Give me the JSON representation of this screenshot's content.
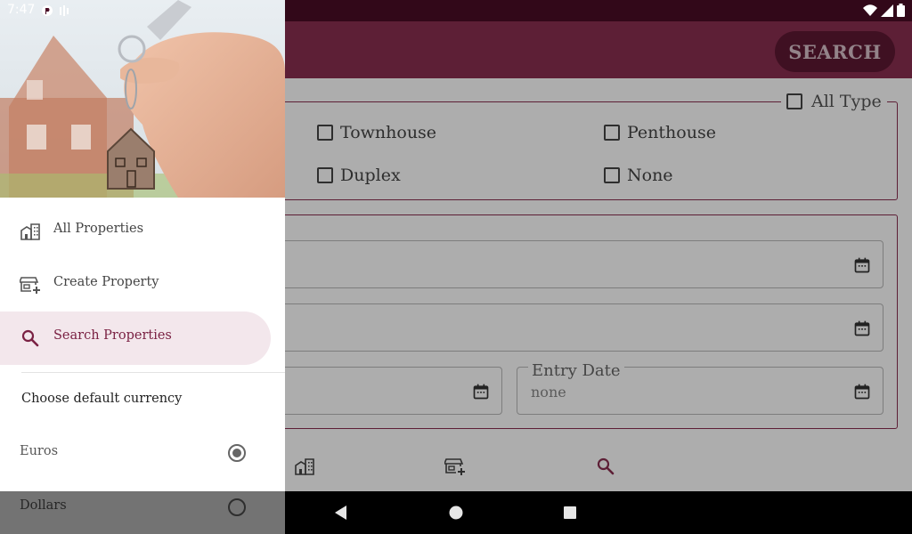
{
  "status_bar": {
    "time": "7:47"
  },
  "app_bar": {
    "search_label": "SEARCH"
  },
  "property_types": {
    "all_label": "All Type",
    "options": [
      "Townhouse",
      "Penthouse",
      "Duplex",
      "None"
    ]
  },
  "date_filters": {
    "entry_date_label": "Entry Date",
    "entry_date_value": "none"
  },
  "drawer": {
    "menu": [
      {
        "label": "All Properties",
        "icon": "building-icon"
      },
      {
        "label": "Create Property",
        "icon": "add-store-icon"
      },
      {
        "label": "Search Properties",
        "icon": "search-icon",
        "active": true
      }
    ],
    "currency_title": "Choose default currency",
    "currencies": [
      {
        "label": "Euros",
        "selected": true
      },
      {
        "label": "Dollars",
        "selected": false
      }
    ]
  },
  "colors": {
    "primary": "#8a2f50",
    "primary_dark": "#4a0d26",
    "active_bg": "#f3e7ec",
    "active_text": "#7a2143"
  }
}
